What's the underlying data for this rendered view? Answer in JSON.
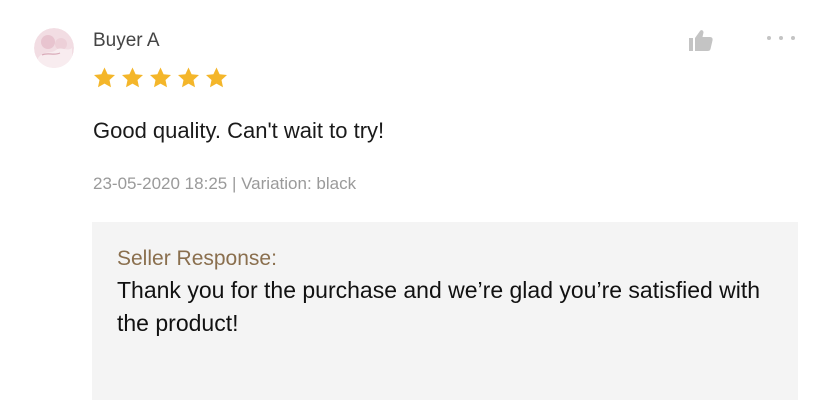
{
  "review": {
    "buyer_name": "Buyer A",
    "rating": 5,
    "max_rating": 5,
    "text": "Good quality. Can't wait to try!",
    "date": "23-05-2020 18:25",
    "separator": " | ",
    "variation": "Variation: black"
  },
  "seller_response": {
    "label": "Seller Response:",
    "text": "Thank you for the purchase and we’re glad you’re satisfied with the product!"
  },
  "icons": {
    "avatar": "avatar",
    "star": "star-icon",
    "like": "thumbs-up-icon",
    "more": "more-options-icon"
  },
  "colors": {
    "star": "#f4b62a",
    "seller_label": "#8a6f4e",
    "meta_text": "#9a9a9a",
    "response_bg": "#f4f4f4"
  }
}
